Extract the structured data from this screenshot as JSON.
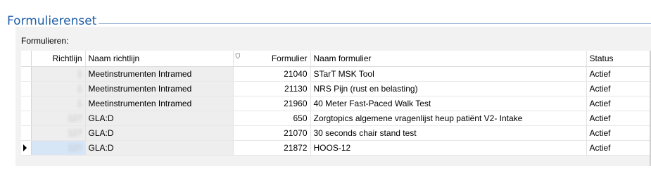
{
  "section": {
    "title": "Formulierenset"
  },
  "grid": {
    "label": "Formulieren:",
    "headers": {
      "richtlijn": "Richtlijn",
      "naam_richtlijn": "Naam richtlijn",
      "formulier": "Formulier",
      "naam_formulier": "Naam formulier",
      "status": "Status"
    },
    "sort_icon": "sort-filter-icon",
    "rows": [
      {
        "richtlijn": "1",
        "naam_richtlijn": "Meetinstrumenten Intramed",
        "formulier": "21040",
        "naam_formulier": "STarT MSK Tool",
        "status": "Actief"
      },
      {
        "richtlijn": "1",
        "naam_richtlijn": "Meetinstrumenten Intramed",
        "formulier": "21130",
        "naam_formulier": "NRS Pijn (rust en belasting)",
        "status": "Actief"
      },
      {
        "richtlijn": "1",
        "naam_richtlijn": "Meetinstrumenten Intramed",
        "formulier": "21960",
        "naam_formulier": "40 Meter Fast-Paced Walk Test",
        "status": "Actief"
      },
      {
        "richtlijn": "127",
        "naam_richtlijn": "GLA:D",
        "formulier": "650",
        "naam_formulier": "Zorgtopics algemene vragenlijst heup patiënt V2- Intake",
        "status": "Actief"
      },
      {
        "richtlijn": "127",
        "naam_richtlijn": "GLA:D",
        "formulier": "21070",
        "naam_formulier": "30 seconds chair stand test",
        "status": "Actief"
      },
      {
        "richtlijn": "127",
        "naam_richtlijn": "GLA:D",
        "formulier": "21872",
        "naam_formulier": "HOOS-12",
        "status": "Actief"
      }
    ]
  }
}
